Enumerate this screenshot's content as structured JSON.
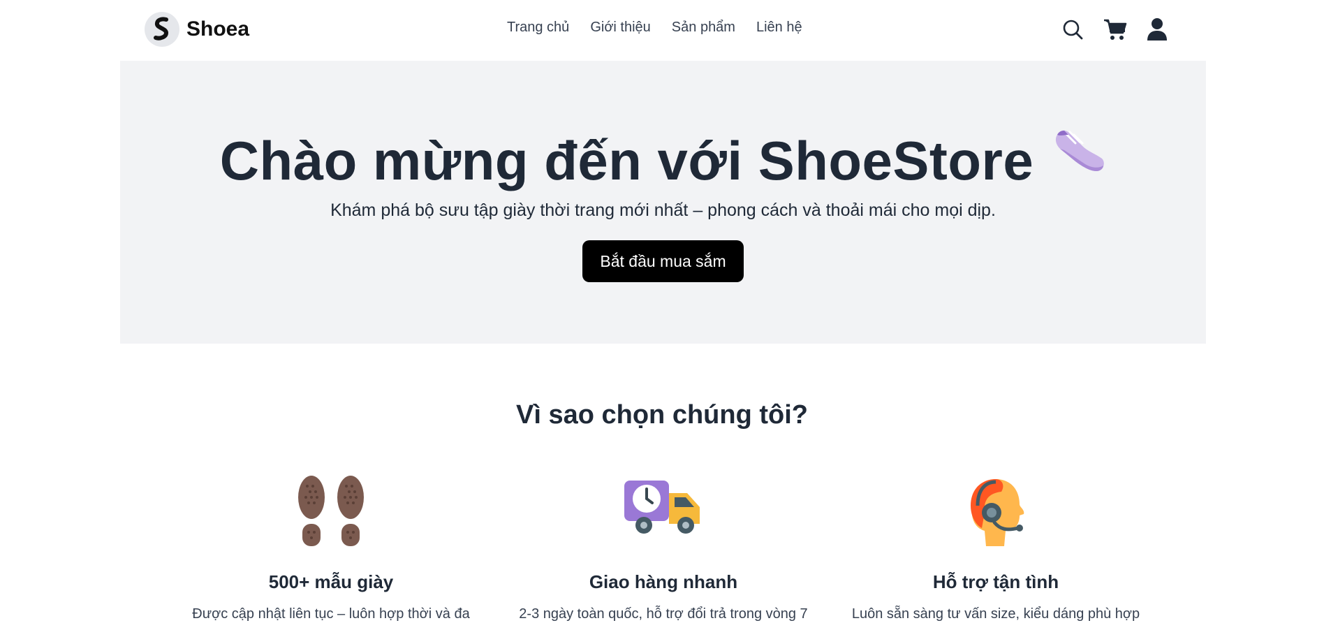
{
  "brand": {
    "name": "Shoea"
  },
  "nav": {
    "items": [
      {
        "label": "Trang chủ"
      },
      {
        "label": "Giới thiệu"
      },
      {
        "label": "Sản phẩm"
      },
      {
        "label": "Liên hệ"
      }
    ]
  },
  "header_icons": [
    "search-icon",
    "cart-icon",
    "user-icon"
  ],
  "hero": {
    "title": "Chào mừng đến với ShoeStore",
    "title_icon": "sneaker-icon",
    "subtitle": "Khám phá bộ sưu tập giày thời trang mới nhất – phong cách và thoải mái cho mọi dịp.",
    "cta_label": "Bắt đầu mua sắm"
  },
  "why": {
    "title": "Vì sao chọn chúng tôi?",
    "features": [
      {
        "icon": "footprints-icon",
        "title": "500+ mẫu giày",
        "text": "Được cập nhật liên tục – luôn hợp thời và đa"
      },
      {
        "icon": "delivery-truck-icon",
        "title": "Giao hàng nhanh",
        "text": "2-3 ngày toàn quốc, hỗ trợ đổi trả trong vòng 7"
      },
      {
        "icon": "support-agent-icon",
        "title": "Hỗ trợ tận tình",
        "text": "Luôn sẵn sàng tư vấn size, kiểu dáng phù hợp"
      }
    ]
  },
  "colors": {
    "hero_bg": "#f2f3f5",
    "text": "#1f2937",
    "cta_bg": "#000000"
  }
}
